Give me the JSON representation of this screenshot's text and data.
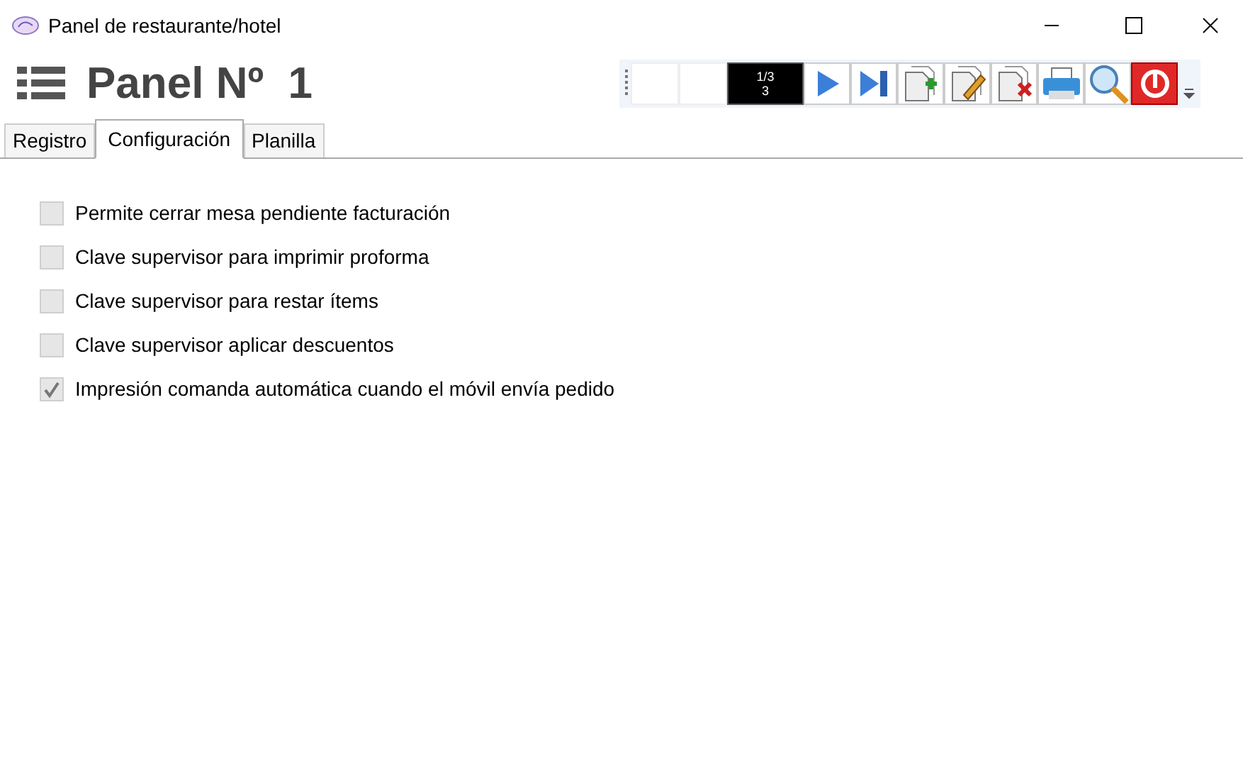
{
  "window": {
    "title": "Panel de restaurante/hotel"
  },
  "header": {
    "title": "Panel Nº  1"
  },
  "toolbar": {
    "counter": {
      "line_1": "1/3",
      "line_2": "3"
    }
  },
  "tabs": [
    {
      "label": "Registro",
      "selected": false
    },
    {
      "label": "Configuración",
      "selected": true
    },
    {
      "label": "Planilla",
      "selected": false
    }
  ],
  "options": [
    {
      "label": "Permite cerrar mesa pendiente facturación",
      "checked": false
    },
    {
      "label": "Clave supervisor para imprimir proforma",
      "checked": false
    },
    {
      "label": "Clave supervisor para restar ítems",
      "checked": false
    },
    {
      "label": "Clave supervisor aplicar descuentos",
      "checked": false
    },
    {
      "label": "Impresión comanda automática cuando el móvil envía pedido",
      "checked": true
    }
  ]
}
